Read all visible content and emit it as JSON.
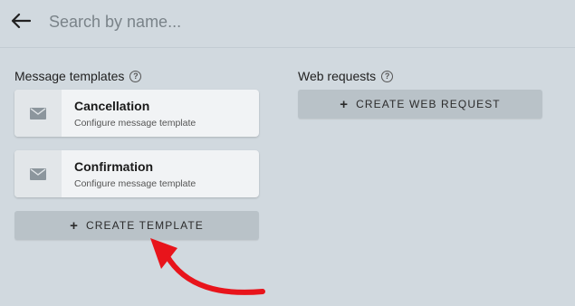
{
  "search": {
    "placeholder": "Search by name..."
  },
  "message_templates": {
    "title": "Message templates",
    "help_glyph": "?",
    "cards": [
      {
        "title": "Cancellation",
        "subtitle": "Configure message template"
      },
      {
        "title": "Confirmation",
        "subtitle": "Configure message template"
      }
    ],
    "create_button": {
      "icon": "+",
      "label": "CREATE TEMPLATE"
    }
  },
  "web_requests": {
    "title": "Web requests",
    "help_glyph": "?",
    "create_button": {
      "icon": "+",
      "label": "CREATE WEB REQUEST"
    }
  },
  "annotation": {
    "arrow_color": "#e8141b"
  }
}
